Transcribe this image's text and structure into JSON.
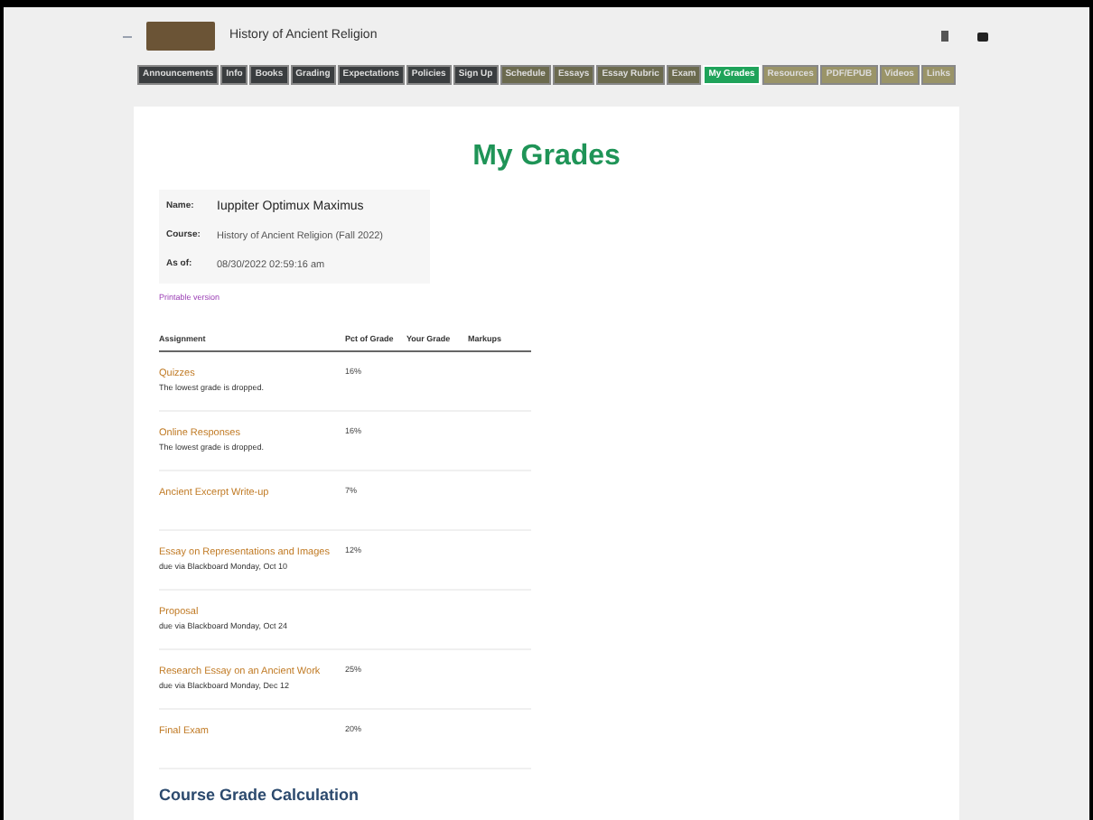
{
  "header": {
    "title": "History of Ancient Religion"
  },
  "nav": [
    {
      "label": "Announcements",
      "color": "#3a3d3f",
      "selected": false
    },
    {
      "label": "Info",
      "color": "#3a3d3f",
      "selected": false
    },
    {
      "label": "Books",
      "color": "#3a3d3f",
      "selected": false
    },
    {
      "label": "Grading",
      "color": "#3a3d3f",
      "selected": false
    },
    {
      "label": "Expectations",
      "color": "#3a3d3f",
      "selected": false
    },
    {
      "label": "Policies",
      "color": "#3a3d3f",
      "selected": false
    },
    {
      "label": "Sign Up",
      "color": "#3a3d3f",
      "selected": false
    },
    {
      "label": "Schedule",
      "color": "#6b6a4e",
      "selected": false
    },
    {
      "label": "Essays",
      "color": "#6b6a4e",
      "selected": false
    },
    {
      "label": "Essay Rubric",
      "color": "#6b6a4e",
      "selected": false
    },
    {
      "label": "Exam",
      "color": "#6b6a4e",
      "selected": false
    },
    {
      "label": "My Grades",
      "color": "#1fa35a",
      "selected": true
    },
    {
      "label": "Resources",
      "color": "#9a9468",
      "selected": false
    },
    {
      "label": "PDF/EPUB",
      "color": "#9a9468",
      "selected": false
    },
    {
      "label": "Videos",
      "color": "#9a9468",
      "selected": false
    },
    {
      "label": "Links",
      "color": "#9a9468",
      "selected": false
    }
  ],
  "page_title": "My Grades",
  "info": [
    {
      "label": "Name:",
      "value": "Iuppiter Optimux Maximus"
    },
    {
      "label": "Course:",
      "value": "History of Ancient Religion (Fall 2022)"
    },
    {
      "label": "As of:",
      "value": "08/30/2022 02:59:16 am"
    }
  ],
  "printable_link": "Printable version",
  "table": {
    "columns": [
      "Assignment",
      "Pct of Grade",
      "Your Grade",
      "Markups"
    ],
    "rows": [
      {
        "assignment": "Quizzes",
        "note": "The lowest grade is dropped.",
        "pct": "16%"
      },
      {
        "assignment": "Online Responses",
        "note": "The lowest grade is dropped.",
        "pct": "16%"
      },
      {
        "assignment": "Ancient Excerpt Write-up",
        "pct": "7%"
      },
      {
        "assignment": "Essay on Representations and Images",
        "note": "due via Blackboard Monday, Oct 10",
        "pct": "12%"
      },
      {
        "assignment": "Proposal",
        "note": "due via Blackboard Monday, Oct 24"
      },
      {
        "assignment": "Research Essay on an Ancient Work",
        "note": "due via Blackboard Monday, Dec 12",
        "pct": "25%"
      },
      {
        "assignment": "Final Exam",
        "pct": "20%"
      }
    ]
  },
  "section_title": "Course Grade Calculation"
}
